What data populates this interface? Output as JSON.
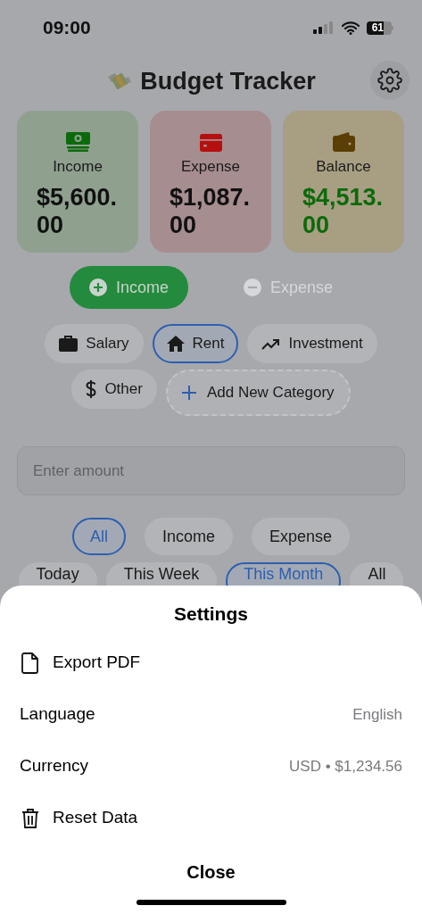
{
  "status_bar": {
    "time": "09:00",
    "battery": "61"
  },
  "header": {
    "title": "Budget Tracker"
  },
  "cards": [
    {
      "kind": "income",
      "label": "Income",
      "amount": "$5,600.00"
    },
    {
      "kind": "expense",
      "label": "Expense",
      "amount": "$1,087.00"
    },
    {
      "kind": "balance",
      "label": "Balance",
      "amount": "$4,513.00"
    }
  ],
  "type_toggle": [
    {
      "label": "Income",
      "selected": true
    },
    {
      "label": "Expense",
      "selected": false
    }
  ],
  "categories": [
    {
      "label": "Salary",
      "selected": false
    },
    {
      "label": "Rent",
      "selected": true
    },
    {
      "label": "Investment",
      "selected": false
    },
    {
      "label": "Other",
      "selected": false
    }
  ],
  "add_category": "Add New Category",
  "amount_field": {
    "placeholder": "Enter amount"
  },
  "type_filter": [
    {
      "label": "All",
      "selected": true
    },
    {
      "label": "Income",
      "selected": false
    },
    {
      "label": "Expense",
      "selected": false
    }
  ],
  "period_filter": [
    {
      "label": "Today",
      "selected": false
    },
    {
      "label": "This Week",
      "selected": false
    },
    {
      "label": "This Month",
      "selected": true
    },
    {
      "label": "All",
      "selected": false
    }
  ],
  "settings": {
    "title": "Settings",
    "items": [
      {
        "kind": "action",
        "label": "Export PDF"
      },
      {
        "kind": "value",
        "label": "Language",
        "value": "English"
      },
      {
        "kind": "value",
        "label": "Currency",
        "value": "USD • $1,234.56"
      },
      {
        "kind": "action",
        "label": "Reset Data"
      }
    ],
    "close": "Close"
  }
}
